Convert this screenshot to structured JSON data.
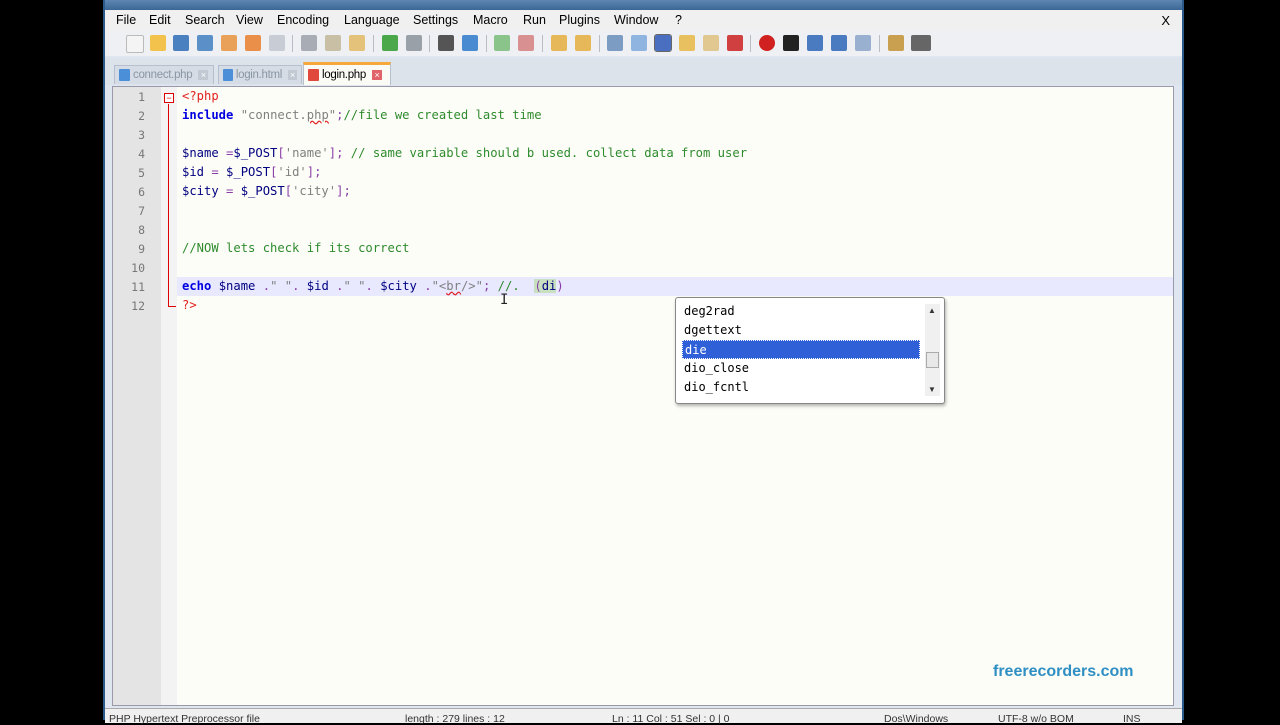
{
  "menu": [
    "File",
    "Edit",
    "Search",
    "View",
    "Encoding",
    "Language",
    "Settings",
    "Macro",
    "Run",
    "Plugins",
    "Window",
    "?"
  ],
  "close_label": "X",
  "tabs": [
    {
      "label": "connect.php",
      "active": false
    },
    {
      "label": "login.html",
      "active": false
    },
    {
      "label": "login.php",
      "active": true
    }
  ],
  "line_numbers": [
    "1",
    "2",
    "3",
    "4",
    "5",
    "6",
    "7",
    "8",
    "9",
    "10",
    "11",
    "12"
  ],
  "code": [
    [
      [
        "<?php",
        "php"
      ]
    ],
    [
      [
        "include",
        "kw"
      ],
      [
        " ",
        ""
      ],
      [
        "\"connect.",
        "str"
      ],
      [
        "php",
        "str sq"
      ],
      [
        "\"",
        "str"
      ],
      [
        ";",
        "op"
      ],
      [
        "//file we created last time",
        "cmt"
      ]
    ],
    [],
    [
      [
        "$name",
        "var"
      ],
      [
        " =",
        "op"
      ],
      [
        "$_POST",
        "var"
      ],
      [
        "[",
        "op"
      ],
      [
        "'name'",
        "str"
      ],
      [
        "];",
        "op"
      ],
      [
        " // same variable should b used. collect data from user",
        "cmt"
      ]
    ],
    [
      [
        "$id",
        "var"
      ],
      [
        " = ",
        "op"
      ],
      [
        "$_POST",
        "var"
      ],
      [
        "[",
        "op"
      ],
      [
        "'id'",
        "str"
      ],
      [
        "];",
        "op"
      ]
    ],
    [
      [
        "$city",
        "var"
      ],
      [
        " = ",
        "op"
      ],
      [
        "$_POST",
        "var"
      ],
      [
        "[",
        "op"
      ],
      [
        "'city'",
        "str"
      ],
      [
        "];",
        "op"
      ]
    ],
    [],
    [],
    [
      [
        "//NOW lets check if its correct",
        "cmt"
      ]
    ],
    [],
    [
      [
        "echo",
        "kw"
      ],
      [
        " ",
        ""
      ],
      [
        "$name",
        "var"
      ],
      [
        " .",
        "op"
      ],
      [
        "\" \"",
        "str"
      ],
      [
        ". ",
        "op"
      ],
      [
        "$id",
        "var"
      ],
      [
        " .",
        "op"
      ],
      [
        "\" \"",
        "str"
      ],
      [
        ". ",
        "op"
      ],
      [
        "$city",
        "var"
      ],
      [
        " .",
        "op"
      ],
      [
        "\"<",
        "str"
      ],
      [
        "br",
        "str sq"
      ],
      [
        "/>\"",
        "str"
      ],
      [
        "; ",
        "op"
      ],
      [
        "//. ",
        "cmt"
      ],
      [
        " ",
        ""
      ],
      [
        "(",
        "op hl"
      ],
      [
        "di",
        "var hl"
      ],
      [
        ")",
        "op"
      ]
    ],
    [
      [
        "?>",
        "php"
      ]
    ]
  ],
  "autocomplete": {
    "items": [
      "deg2rad",
      "dgettext",
      "die",
      "dio_close",
      "dio_fcntl"
    ],
    "selected": "die"
  },
  "watermark": "freerecorders.com",
  "status": {
    "type": "PHP Hypertext Preprocessor file",
    "length": "length : 279    lines : 12",
    "position": "Ln : 11    Col : 51    Sel : 0 | 0",
    "eol": "Dos\\Windows",
    "encoding": "UTF-8 w/o BOM",
    "mode": "INS"
  },
  "colors": {
    "accent_tab": "#f6a93a",
    "selection": "#3060d8",
    "watermark": "#2e8fc4"
  }
}
